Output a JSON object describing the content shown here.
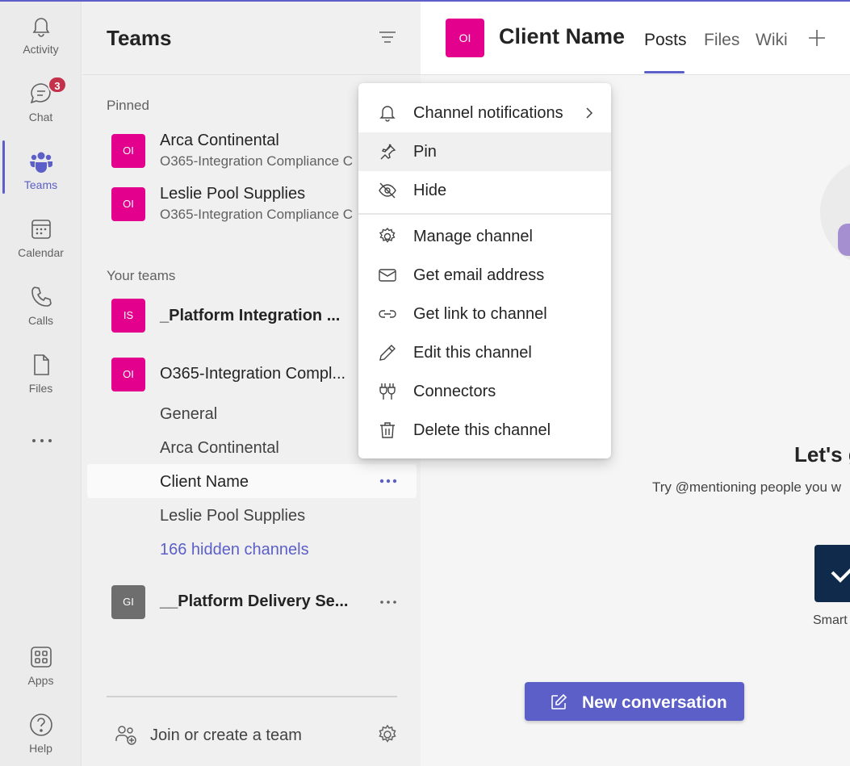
{
  "rail": {
    "items": [
      {
        "label": "Activity",
        "icon": "bell-icon"
      },
      {
        "label": "Chat",
        "icon": "chat-icon",
        "badge": "3"
      },
      {
        "label": "Teams",
        "icon": "teams-icon",
        "active": true
      },
      {
        "label": "Calendar",
        "icon": "calendar-icon"
      },
      {
        "label": "Calls",
        "icon": "phone-icon"
      },
      {
        "label": "Files",
        "icon": "file-icon"
      },
      {
        "label": "Apps",
        "icon": "apps-icon"
      },
      {
        "label": "Help",
        "icon": "help-icon"
      }
    ]
  },
  "panel": {
    "title": "Teams",
    "pinned_label": "Pinned",
    "pinned": [
      {
        "avatar": "OI",
        "name": "Arca Continental",
        "team": "O365-Integration Compliance C"
      },
      {
        "avatar": "OI",
        "name": "Leslie Pool Supplies",
        "team": "O365-Integration Compliance C"
      }
    ],
    "your_teams_label": "Your teams",
    "teams": [
      {
        "avatar": "IS",
        "name": "_Platform Integration ..."
      },
      {
        "avatar": "OI",
        "name": "O365-Integration Compl...",
        "channels": [
          "General",
          "Arca Continental",
          "Client Name",
          "Leslie Pool Supplies"
        ],
        "hidden_channels": "166 hidden channels"
      },
      {
        "avatar": "GI",
        "name": "__Platform Delivery Se..."
      }
    ],
    "join_label": "Join or create a team"
  },
  "main": {
    "avatar": "OI",
    "title": "Client Name",
    "tabs": [
      "Posts",
      "Files",
      "Wiki"
    ],
    "active_tab": "Posts",
    "welcome_heading": "Let's g",
    "welcome_text": "Try @mentioning people you w",
    "app_label": "Smart",
    "new_conversation": "New conversation"
  },
  "menu": {
    "items": [
      {
        "label": "Channel notifications",
        "icon": "bell-icon",
        "submenu": true
      },
      {
        "label": "Pin",
        "icon": "pin-icon",
        "highlighted": true
      },
      {
        "label": "Hide",
        "icon": "eye-off-icon"
      },
      {
        "label": "Manage channel",
        "icon": "gear-icon"
      },
      {
        "label": "Get email address",
        "icon": "mail-icon"
      },
      {
        "label": "Get link to channel",
        "icon": "link-icon"
      },
      {
        "label": "Edit this channel",
        "icon": "pencil-icon"
      },
      {
        "label": "Connectors",
        "icon": "plug-icon"
      },
      {
        "label": "Delete this channel",
        "icon": "trash-icon"
      }
    ]
  },
  "colors": {
    "accent": "#5b5fc7",
    "team_avatar": "#e3008c",
    "gray_avatar": "#6e6e6e",
    "badge": "#c4314b"
  }
}
